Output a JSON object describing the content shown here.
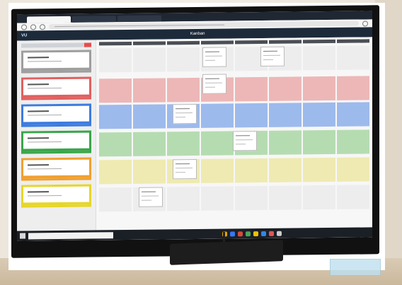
{
  "scene": {
    "description_colors": {
      "red": "#e9a2a2",
      "blue": "#7fa6ea",
      "green": "#9fd39a",
      "yellow": "#ece59a",
      "gray": "#eaeaea"
    }
  },
  "app": {
    "title": "Kanban",
    "brand": "VU"
  },
  "sidebar": {
    "cards": [
      {
        "color": "#9e9e9e"
      },
      {
        "color": "#e06060"
      },
      {
        "color": "#3d7be0"
      },
      {
        "color": "#3aa64a"
      },
      {
        "color": "#f0a030"
      },
      {
        "color": "#e6d62a"
      }
    ]
  },
  "grid": {
    "columns": 8
  },
  "taskbar": {
    "icons": [
      "#e8a200",
      "#3478f6",
      "#d54b3b",
      "#4aa55c",
      "#f0c000",
      "#2f86eb",
      "#e05555",
      "#cccccc"
    ]
  }
}
